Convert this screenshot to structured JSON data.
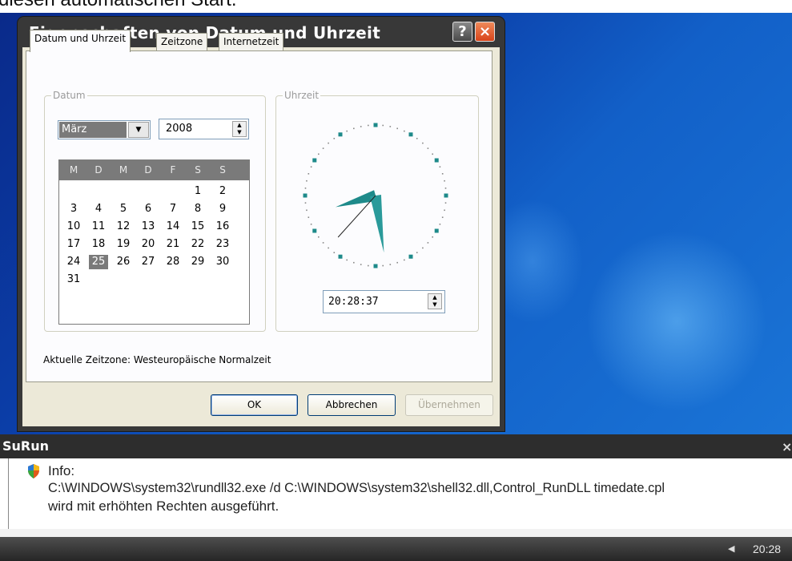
{
  "page_text": "diesen automatischen Start.",
  "dialog": {
    "title": "Eigenschaften von Datum und Uhrzeit",
    "help_label": "?",
    "close_label": "×",
    "tabs": [
      "Datum und Uhrzeit",
      "Zeitzone",
      "Internetzeit"
    ],
    "date_group_label": "Datum",
    "time_group_label": "Uhrzeit",
    "month": "März",
    "year": "2008",
    "weekday_headers": [
      "M",
      "D",
      "M",
      "D",
      "F",
      "S",
      "S"
    ],
    "calendar_rows": [
      [
        "",
        "",
        "",
        "",
        "",
        "1",
        "2"
      ],
      [
        "3",
        "4",
        "5",
        "6",
        "7",
        "8",
        "9"
      ],
      [
        "10",
        "11",
        "12",
        "13",
        "14",
        "15",
        "16"
      ],
      [
        "17",
        "18",
        "19",
        "20",
        "21",
        "22",
        "23"
      ],
      [
        "24",
        "25",
        "26",
        "27",
        "28",
        "29",
        "30"
      ],
      [
        "31",
        "",
        "",
        "",
        "",
        "",
        ""
      ]
    ],
    "selected_day": "25",
    "time": "20:28:37",
    "timezone_text": "Aktuelle Zeitzone: Westeuropäische Normalzeit",
    "buttons": {
      "ok": "OK",
      "cancel": "Abbrechen",
      "apply": "Übernehmen"
    }
  },
  "surun": {
    "title": "SuRun",
    "close_label": "×",
    "info_label": "Info:",
    "command": "C:\\WINDOWS\\system32\\rundll32.exe /d C:\\WINDOWS\\system32\\shell32.dll,Control_RunDLL timedate.cpl",
    "message": "wird mit erhöhten Rechten ausgeführt."
  },
  "taskbar": {
    "clock": "20:28"
  },
  "colors": {
    "title_bar": "#383838",
    "dialog_face": "#ece9d8",
    "panel": "#fcfcfe",
    "selected": "#7a7a7a",
    "clock_hand": "#1e8a8a",
    "desktop": "#0b3ea8"
  }
}
